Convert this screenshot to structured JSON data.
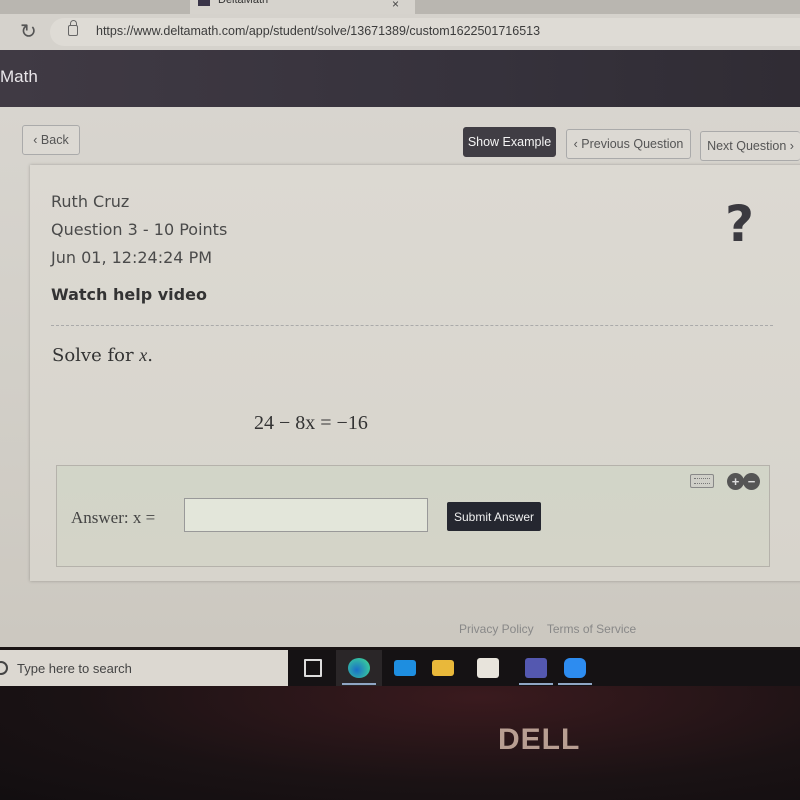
{
  "browser": {
    "tab_title": "DeltaMath",
    "url": "https://www.deltamath.com/app/student/solve/13671389/custom1622501716513"
  },
  "navbar": {
    "brand": "Math"
  },
  "toolbar": {
    "back_label": "Back",
    "show_example_label": "Show Example",
    "previous_question_label": "Previous Question",
    "next_question_label": "Next Question"
  },
  "question": {
    "student_name": "Ruth Cruz",
    "info": "Question 3 - 10 Points",
    "timestamp": "Jun 01, 12:24:24 PM",
    "help_link": "Watch help video",
    "help_icon": "?",
    "prompt_text": "Solve for ",
    "prompt_var": "x",
    "equation": "24 − 8x = −16"
  },
  "answer": {
    "label": "Answer:  x =",
    "value": "",
    "submit_label": "Submit Answer",
    "zoom_in": "+",
    "zoom_out": "−"
  },
  "footer": {
    "privacy": "Privacy Policy",
    "terms": "Terms of Service"
  },
  "taskbar": {
    "search_placeholder": "Type here to search",
    "apps": [
      "task-view",
      "edge",
      "mail",
      "file-explorer",
      "store",
      "teams",
      "zoom"
    ]
  },
  "device": {
    "brand": "DELL"
  }
}
